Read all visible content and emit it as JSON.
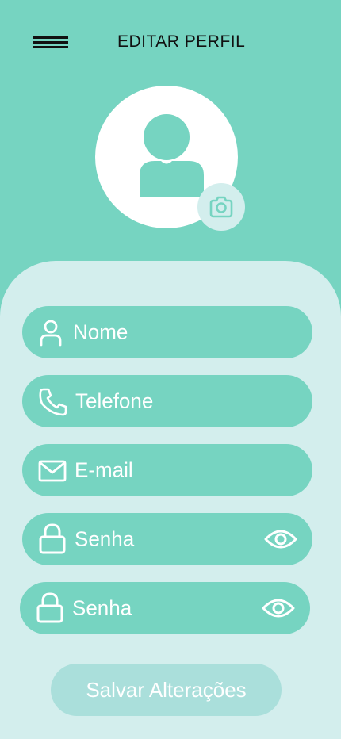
{
  "header": {
    "menu_icon": "hamburger-menu-icon",
    "title": "EDITAR PERFIL"
  },
  "profile": {
    "avatar_icon": "user-avatar-icon",
    "camera_icon": "camera-icon"
  },
  "form": {
    "name": {
      "label": "Nome",
      "icon": "user-icon"
    },
    "phone": {
      "label": "Telefone",
      "icon": "phone-icon"
    },
    "email": {
      "label": "E-mail",
      "icon": "mail-icon"
    },
    "password": {
      "label": "Senha",
      "icon": "lock-icon",
      "toggle_icon": "eye-icon"
    },
    "password_confirm": {
      "label": "Senha",
      "icon": "lock-icon",
      "toggle_icon": "eye-icon"
    }
  },
  "actions": {
    "save_label": "Salvar Alterações"
  },
  "colors": {
    "primary": "#76D4C1",
    "panel": "#D3EEED",
    "button_disabled": "#AADFDB",
    "text": "#ffffff"
  }
}
